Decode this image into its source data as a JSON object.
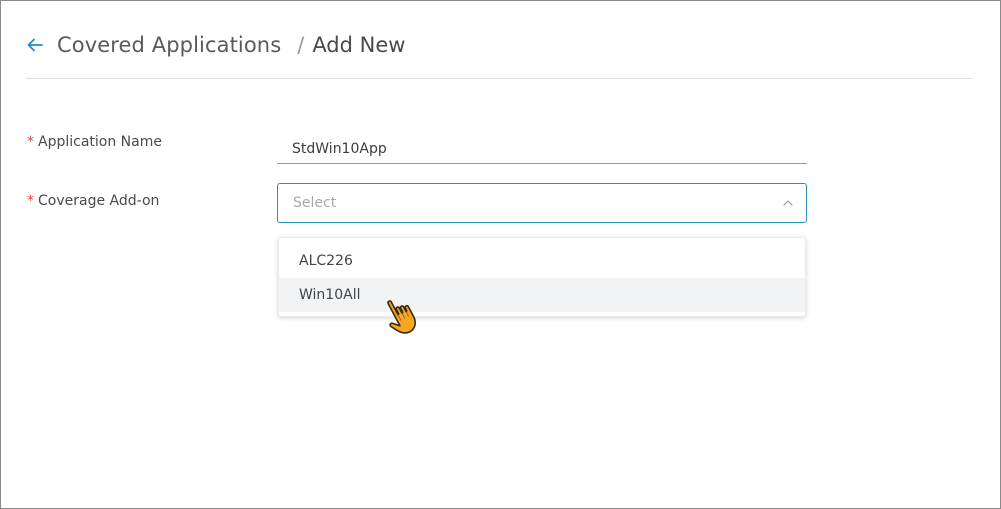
{
  "header": {
    "back_icon": "arrow-left-icon",
    "breadcrumb_parent": "Covered Applications",
    "breadcrumb_separator": "/",
    "breadcrumb_current": "Add New"
  },
  "form": {
    "required_marker": "*",
    "application_name": {
      "label": "Application Name",
      "value": "StdWin10App"
    },
    "coverage_addon": {
      "label": "Coverage Add-on",
      "placeholder": "Select",
      "expanded": true,
      "chevron_icon": "chevron-up-icon",
      "options": [
        "ALC226",
        "Win10All"
      ],
      "hovered_option": "Win10All"
    }
  },
  "colors": {
    "accent": "#2a8fb8",
    "required": "#e0463f",
    "hover_bg": "#f2f3f5",
    "cursor_fill": "#f5a623"
  },
  "cursor_icon": "hand-pointer-icon"
}
